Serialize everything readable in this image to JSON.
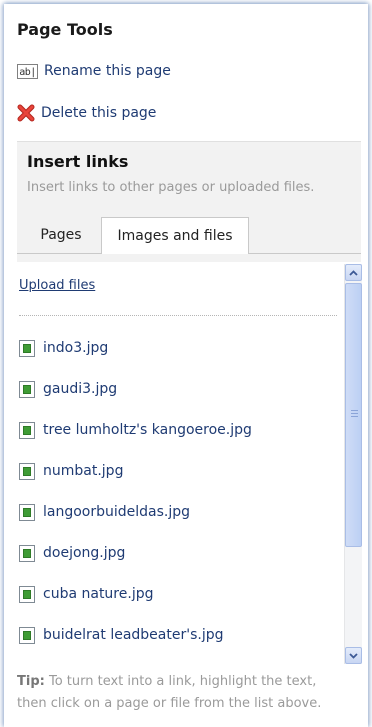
{
  "page_tools": {
    "title": "Page Tools",
    "rename": {
      "icon": "rename-icon",
      "icon_text": "ab|",
      "label": "Rename this page"
    },
    "delete": {
      "icon": "delete-x-icon",
      "label": "Delete this page"
    }
  },
  "insert_links": {
    "title": "Insert links",
    "description": "Insert links to other pages or uploaded files.",
    "tabs": [
      {
        "label": "Pages",
        "active": false
      },
      {
        "label": "Images and files",
        "active": true
      }
    ]
  },
  "files": {
    "upload_label": "Upload files",
    "items": [
      {
        "name": "indo3.jpg",
        "icon": "image-file-icon"
      },
      {
        "name": "gaudi3.jpg",
        "icon": "image-file-icon"
      },
      {
        "name": "tree lumholtz's kangoeroe.jpg",
        "icon": "image-file-icon"
      },
      {
        "name": "numbat.jpg",
        "icon": "image-file-icon"
      },
      {
        "name": "langoorbuideldas.jpg",
        "icon": "image-file-icon"
      },
      {
        "name": "doejong.jpg",
        "icon": "image-file-icon"
      },
      {
        "name": "cuba nature.jpg",
        "icon": "image-file-icon"
      },
      {
        "name": "buidelrat leadbeater's.jpg",
        "icon": "image-file-icon"
      }
    ]
  },
  "tip": {
    "label": "Tip:",
    "line1": "To turn text into a link, highlight the text,",
    "line2": "then click on a page or file from the list above."
  },
  "colors": {
    "link": "#1f3b73",
    "muted": "#9a9a9a",
    "panel_bg": "#f2f2f2",
    "scrollbar": "#c8d6f3"
  }
}
